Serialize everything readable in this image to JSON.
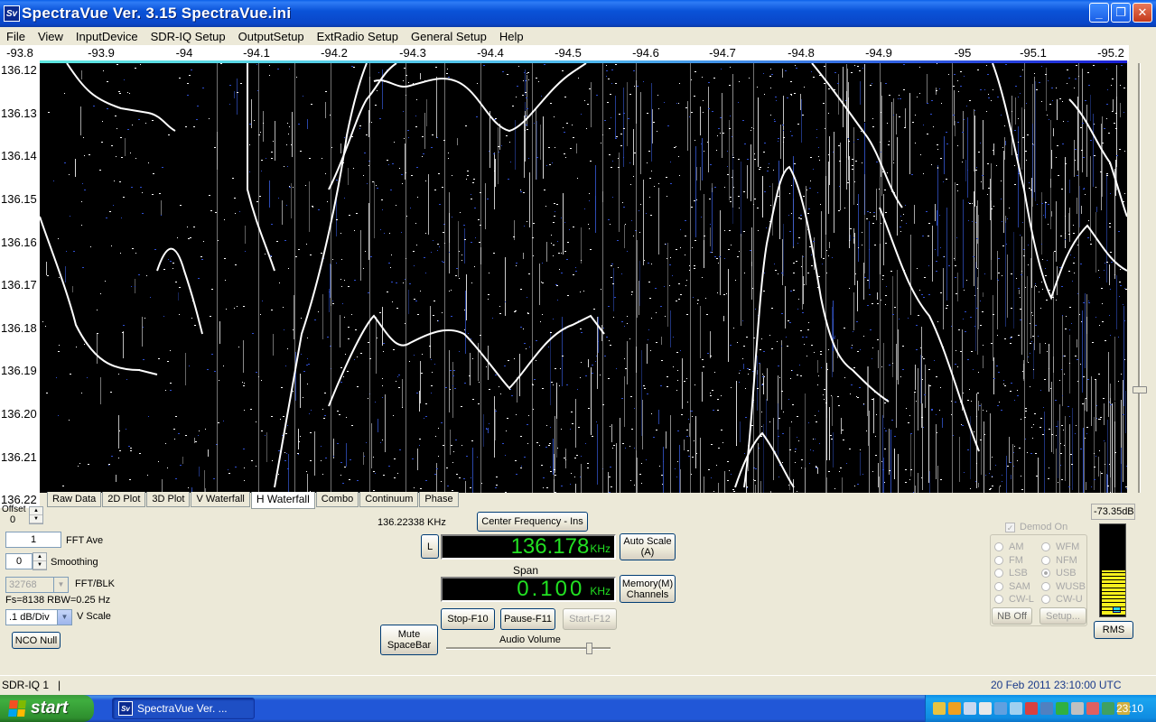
{
  "window": {
    "title": "SpectraVue Ver. 3.15  SpectraVue.ini",
    "app_icon": "Sv",
    "minimize": "_",
    "maximize": "❐",
    "close": "✕"
  },
  "menu": [
    "File",
    "View",
    "InputDevice",
    "SDR-IQ Setup",
    "OutputSetup",
    "ExtRadio Setup",
    "General Setup",
    "Help"
  ],
  "freq_axis": {
    "labels": [
      "-93.8",
      "-93.9",
      "-94",
      "-94.1",
      "-94.2",
      "-94.3",
      "-94.4",
      "-94.5",
      "-94.6",
      "-94.7",
      "-94.8",
      "-94.9",
      "-95",
      "-95.1",
      "-95.2"
    ]
  },
  "time_axis": {
    "labels": [
      "136.12",
      "136.13",
      "136.14",
      "136.15",
      "136.16",
      "136.17",
      "136.18",
      "136.19",
      "136.20",
      "136.21",
      "136.22"
    ]
  },
  "tabs": [
    "Raw Data",
    "2D Plot",
    "3D Plot",
    "V Waterfall",
    "H Waterfall",
    "Combo",
    "Continuum",
    "Phase"
  ],
  "active_tab": "H Waterfall",
  "controls": {
    "offset_label": "Offset",
    "offset_value": "0",
    "fft_ave_value": "1",
    "fft_ave_label": "FFT Ave",
    "smoothing_value": "0",
    "smoothing_label": "Smoothing",
    "fft_blk_value": "32768",
    "fft_blk_label": "FFT/BLK",
    "fs_info": "Fs=8138 RBW=0.25 Hz",
    "vscale_value": ".1 dB/Div",
    "vscale_label": "V Scale",
    "nco_null": "NCO Null"
  },
  "center": {
    "cursor_freq": "136.22338 KHz",
    "center_freq_button": "Center Frequency - Ins",
    "l_button": "L",
    "freq_value": "136.178",
    "freq_unit": "KHz",
    "auto_scale": "Auto Scale\n(A)",
    "span_label": "Span",
    "span_value": "0.100",
    "span_unit": "KHz",
    "memory": "Memory(M)\nChannels",
    "stop": "Stop-F10",
    "pause": "Pause-F11",
    "start": "Start-F12",
    "mute": "Mute\nSpaceBar",
    "audio_volume_label": "Audio Volume",
    "audio_volume_level": 0.87
  },
  "demod": {
    "demod_on_label": "Demod On",
    "modes": [
      "AM",
      "WFM",
      "FM",
      "NFM",
      "LSB",
      "USB",
      "SAM",
      "WUSB",
      "CW-L",
      "CW-U"
    ],
    "selected": "USB",
    "nb_off": "NB Off",
    "setup": "Setup..."
  },
  "meter": {
    "reading": "-73.35dB",
    "rms_button": "RMS",
    "level": 0.5
  },
  "statusbar": {
    "device": "SDR-IQ 1",
    "datetime": "20 Feb 2011   23:10:00 UTC"
  },
  "taskbar": {
    "start": "start",
    "task": "SpectraVue Ver. ...",
    "clock": "23:10"
  },
  "colors": {
    "lcd_green": "#22e022",
    "meter_yellow": "#f6f01d",
    "titlebar_blue": "#0a53d8"
  }
}
